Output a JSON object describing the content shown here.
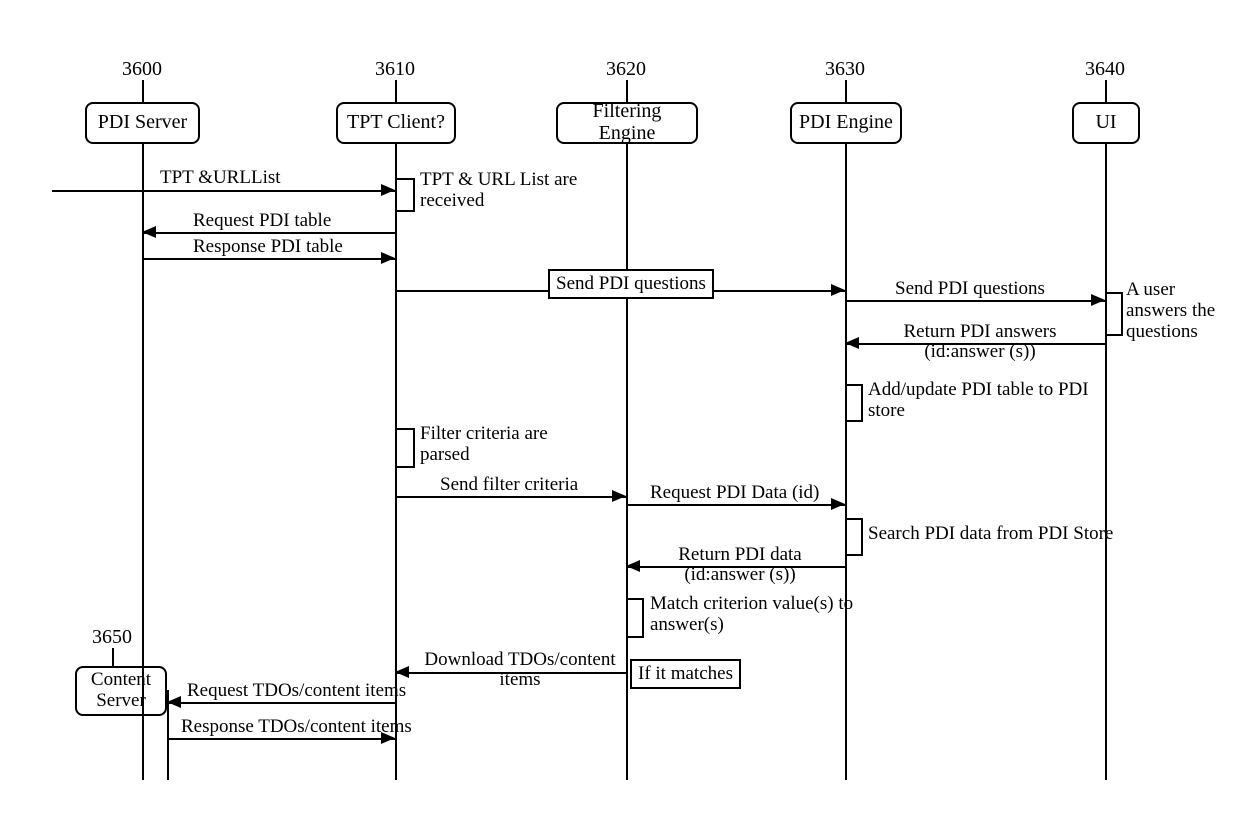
{
  "participants": {
    "pdi_server": {
      "id": "3600",
      "label": "PDI Server"
    },
    "tpt_client": {
      "id": "3610",
      "label": "TPT Client?"
    },
    "filter_eng": {
      "id": "3620",
      "label": "Filtering Engine"
    },
    "pdi_engine": {
      "id": "3630",
      "label": "PDI Engine"
    },
    "ui": {
      "id": "3640",
      "label": "UI"
    },
    "content_srv": {
      "id": "3650",
      "label": "Content\nServer"
    }
  },
  "messages": {
    "tpt_urllist": "TPT &URLList",
    "tpt_url_received": "TPT & URL List are\nreceived",
    "req_pdi_table": "Request PDI  table",
    "resp_pdi_table": "Response PDI   table",
    "send_pdi_q1": "Send PDI questions",
    "send_pdi_q2": "Send PDI questions",
    "return_pdi_ans": "Return PDI answers\n(id:answer (s))",
    "user_answers": "A user\nanswers the\nquestions",
    "add_update_store": "Add/update PDI table to PDI\nstore",
    "filter_parsed": "Filter criteria are\nparsed",
    "send_filter_crit": "Send filter criteria",
    "req_pdi_data": "Request PDI Data (id)",
    "search_pdi": "Search PDI data from PDI Store",
    "return_pdi_data": "Return PDI data\n(id:answer (s))",
    "match_crit": "Match criterion value(s) to\nanswer(s)",
    "download_tdos": "Download TDOs/content\nitems",
    "if_matches": "If it matches",
    "req_tdos": "Request TDOs/content items",
    "resp_tdos": "Response TDOs/content items"
  },
  "chart_data": {
    "type": "sequence_diagram",
    "participants": [
      {
        "id": "3600",
        "name": "PDI Server"
      },
      {
        "id": "3610",
        "name": "TPT Client?"
      },
      {
        "id": "3620",
        "name": "Filtering Engine"
      },
      {
        "id": "3630",
        "name": "PDI Engine"
      },
      {
        "id": "3640",
        "name": "UI"
      },
      {
        "id": "3650",
        "name": "Content Server"
      }
    ],
    "interactions": [
      {
        "from": "external",
        "to": "TPT Client?",
        "label": "TPT &URLList",
        "direction": "right"
      },
      {
        "at": "TPT Client?",
        "self": true,
        "label": "TPT & URL List are received"
      },
      {
        "from": "TPT Client?",
        "to": "PDI Server",
        "label": "Request PDI table",
        "direction": "left"
      },
      {
        "from": "PDI Server",
        "to": "TPT Client?",
        "label": "Response PDI table",
        "direction": "right"
      },
      {
        "from": "TPT Client?",
        "to": "PDI Engine",
        "label": "Send PDI questions",
        "direction": "right",
        "boxed_mid": true
      },
      {
        "from": "PDI Engine",
        "to": "UI",
        "label": "Send PDI questions",
        "direction": "right"
      },
      {
        "at": "UI",
        "self": true,
        "label": "A user answers the questions"
      },
      {
        "from": "UI",
        "to": "PDI Engine",
        "label": "Return PDI answers (id:answer (s))",
        "direction": "left"
      },
      {
        "at": "PDI Engine",
        "self": true,
        "label": "Add/update PDI table to PDI store"
      },
      {
        "at": "TPT Client?",
        "self": true,
        "label": "Filter criteria are parsed"
      },
      {
        "from": "TPT Client?",
        "to": "Filtering Engine",
        "label": "Send filter criteria",
        "direction": "right"
      },
      {
        "from": "Filtering Engine",
        "to": "PDI Engine",
        "label": "Request PDI Data (id)",
        "direction": "right"
      },
      {
        "at": "PDI Engine",
        "self": true,
        "label": "Search PDI data from PDI Store"
      },
      {
        "from": "PDI Engine",
        "to": "Filtering Engine",
        "label": "Return PDI data (id:answer (s))",
        "direction": "left"
      },
      {
        "at": "Filtering Engine",
        "self": true,
        "label": "Match criterion value(s) to answer(s)"
      },
      {
        "from": "Filtering Engine",
        "to": "TPT Client?",
        "label": "Download TDOs/content items",
        "direction": "left",
        "guard": "If it matches"
      },
      {
        "from": "TPT Client?",
        "to": "Content Server",
        "label": "Request TDOs/content items",
        "direction": "left"
      },
      {
        "from": "Content Server",
        "to": "TPT Client?",
        "label": "Response TDOs/content items",
        "direction": "right"
      }
    ]
  }
}
